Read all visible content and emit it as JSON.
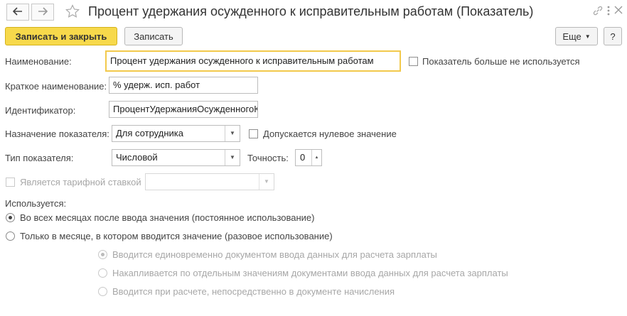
{
  "header": {
    "title": "Процент удержания осужденного к исправительным работам (Показатель)",
    "back_icon": "arrow-left",
    "forward_icon": "arrow-right",
    "favorite_icon": "star",
    "link_icon": "link",
    "more_icon": "more-vertical",
    "close_icon": "close"
  },
  "toolbar": {
    "save_close_label": "Записать и закрыть",
    "save_label": "Записать",
    "more_label": "Еще",
    "help_label": "?"
  },
  "form": {
    "name_label": "Наименование:",
    "name_value": "Процент удержания осужденного к исправительным работам",
    "not_used_label": "Показатель больше не используется",
    "short_name_label": "Краткое наименование:",
    "short_name_value": "% удерж. исп. работ",
    "identifier_label": "Идентификатор:",
    "identifier_value": "ПроцентУдержанияОсужденногоК",
    "purpose_label": "Назначение показателя:",
    "purpose_value": "Для сотрудника",
    "zero_allowed_label": "Допускается нулевое значение",
    "type_label": "Тип показателя:",
    "type_value": "Числовой",
    "precision_label": "Точность:",
    "precision_value": "0",
    "tariff_label": "Является тарифной ставкой",
    "tariff_value": "",
    "usage_label": "Используется:",
    "usage_options": [
      "Во всех месяцах после ввода значения (постоянное использование)",
      "Только в месяце, в котором вводится значение (разовое использование)"
    ],
    "sub_options": [
      "Вводится единовременно документом ввода данных для расчета зарплаты",
      "Накапливается по отдельным значениям документами ввода данных для расчета зарплаты",
      "Вводится при расчете, непосредственно в документе начисления"
    ]
  }
}
